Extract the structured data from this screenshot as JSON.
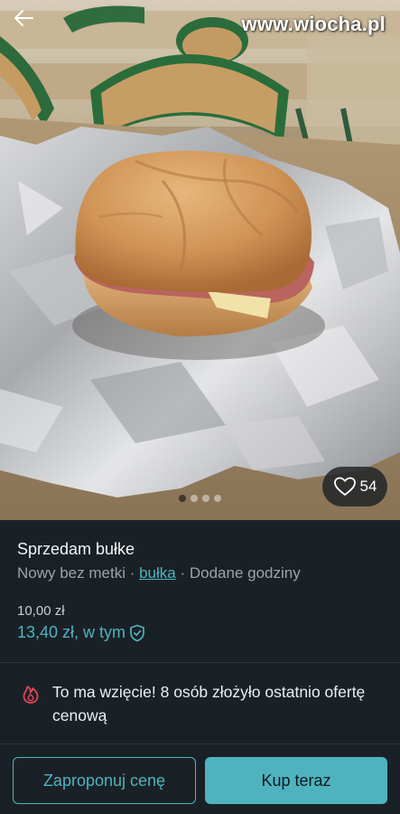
{
  "watermark": "www.wiocha.pl",
  "photo": {
    "likes": "54",
    "gallery_count": 4,
    "gallery_active_index": 0
  },
  "listing": {
    "title": "Sprzedam bułke",
    "condition": "Nowy bez metki",
    "separator": " · ",
    "tag": "bułka",
    "added": "Dodane godziny",
    "price": "10,00 zł",
    "price_total": "13,40 zł, w tym"
  },
  "promo": {
    "icon": "flame-icon",
    "text": "To ma wzięcie! 8 osób złożyło ostatnio ofertę cenową"
  },
  "actions": {
    "offer_label": "Zaproponuj cenę",
    "buy_label": "Kup teraz"
  },
  "colors": {
    "accent": "#4fb3bf",
    "background": "#1a2126",
    "promo_icon": "#e0455a"
  }
}
